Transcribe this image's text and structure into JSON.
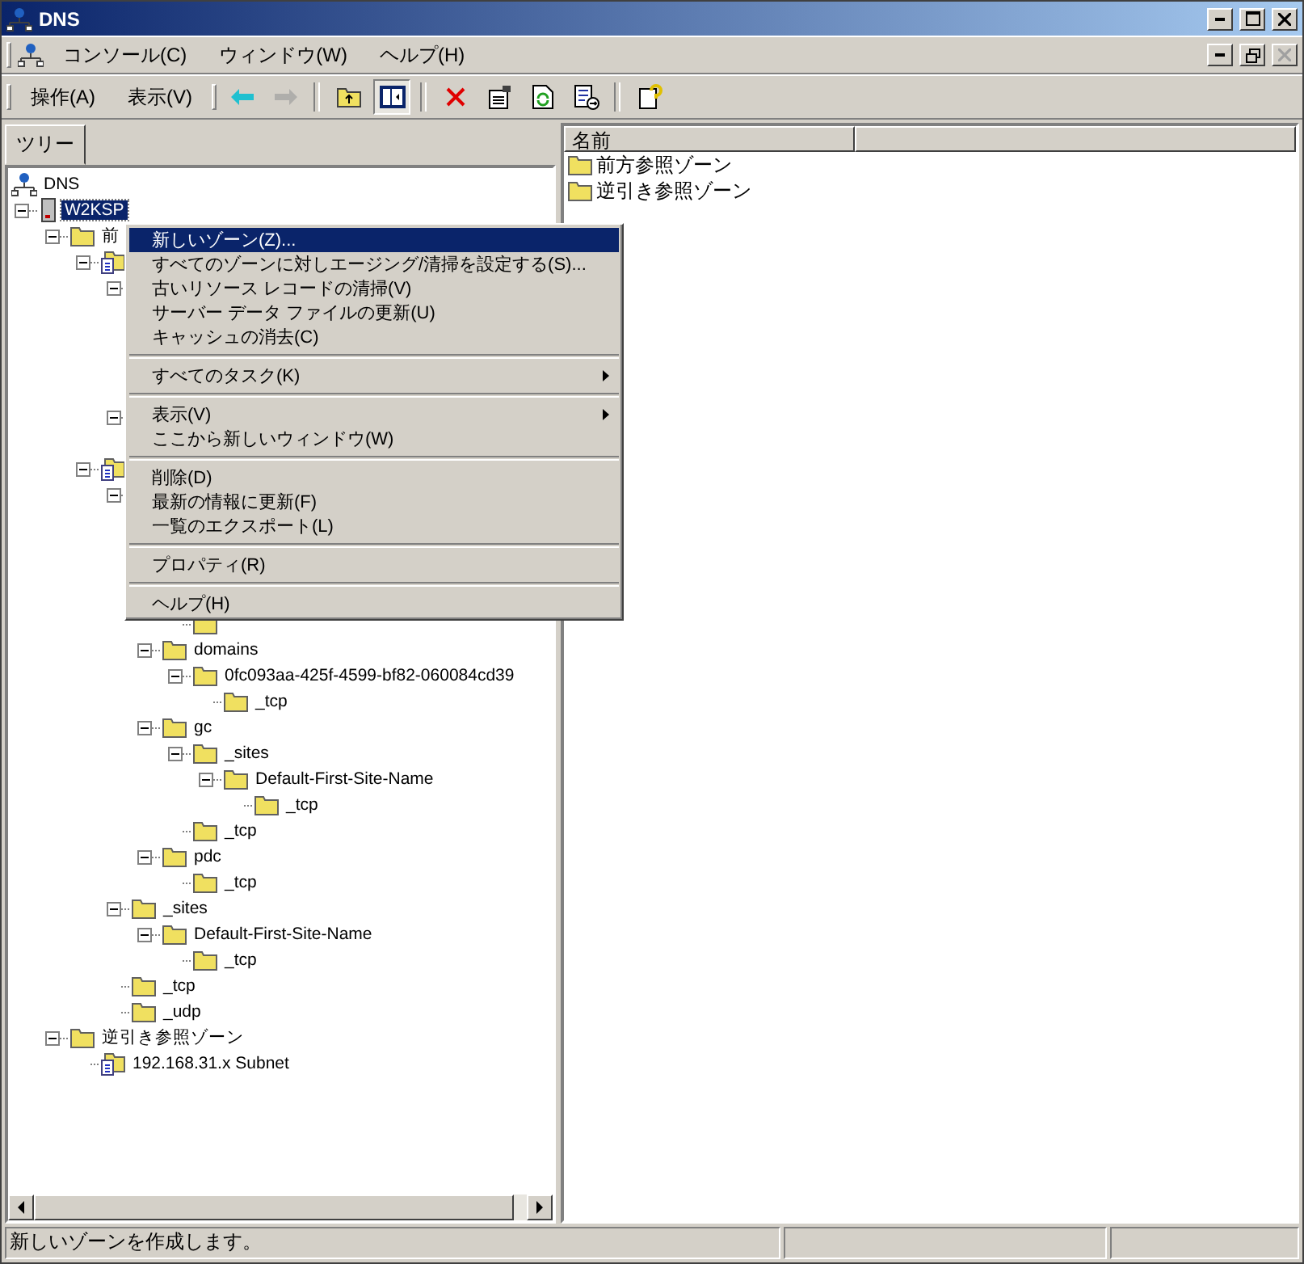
{
  "window": {
    "title": "DNS"
  },
  "menu_bar": [
    "コンソール(C)",
    "ウィンドウ(W)",
    "ヘルプ(H)"
  ],
  "action_menu": [
    "操作(A)",
    "表示(V)"
  ],
  "toolbar": [
    {
      "kind": "back",
      "disabled": false
    },
    {
      "kind": "forward",
      "disabled": true
    },
    {
      "kind": "sep"
    },
    {
      "kind": "up",
      "disabled": false
    },
    {
      "kind": "tree",
      "disabled": false,
      "pressed": true
    },
    {
      "kind": "sep"
    },
    {
      "kind": "delete",
      "disabled": false
    },
    {
      "kind": "properties",
      "disabled": false
    },
    {
      "kind": "refresh",
      "disabled": false
    },
    {
      "kind": "export",
      "disabled": false
    },
    {
      "kind": "sep"
    },
    {
      "kind": "help",
      "disabled": false
    }
  ],
  "tree_tab": "ツリー",
  "tree": [
    {
      "label": "DNS",
      "kind": "dns",
      "children": [
        {
          "label": "W2KSP",
          "kind": "server",
          "expanded": true,
          "selected": true,
          "children": [
            {
              "label": "前",
              "kind": "folder",
              "expanded": true,
              "selected": false,
              "children": [
                {
                  "kind": "zone",
                  "expanded": true,
                  "children": [
                    {
                      "kind": "folder",
                      "expanded": true,
                      "children": [
                        {
                          "kind": "folder"
                        },
                        {
                          "kind": "folder"
                        },
                        {
                          "kind": "folder"
                        },
                        {
                          "kind": "folder"
                        }
                      ]
                    },
                    {
                      "kind": "folder",
                      "expanded": true,
                      "children": [
                        {
                          "kind": "folder"
                        }
                      ]
                    }
                  ]
                },
                {
                  "kind": "zone",
                  "expanded": true,
                  "children": [
                    {
                      "kind": "folder",
                      "expanded": true,
                      "children": [
                        {
                          "kind": "folder",
                          "children": [
                            {
                              "kind": "folder",
                              "children": [
                                {
                                  "kind": "folder",
                                  "children": [
                                    {
                                      "kind": "folder"
                                    }
                                  ]
                                }
                              ]
                            },
                            {
                              "kind": "folder"
                            }
                          ]
                        },
                        {
                          "label": "domains",
                          "kind": "folder",
                          "expanded": true,
                          "selected": false,
                          "children": [
                            {
                              "label": "0fc093aa-425f-4599-bf82-060084cd39",
                              "kind": "folder",
                              "expanded": true,
                              "selected": false,
                              "children": [
                                {
                                  "label": "_tcp",
                                  "kind": "folder",
                                  "selected": false
                                }
                              ]
                            }
                          ]
                        },
                        {
                          "label": "gc",
                          "kind": "folder",
                          "expanded": true,
                          "selected": false,
                          "children": [
                            {
                              "label": "_sites",
                              "kind": "folder",
                              "expanded": true,
                              "selected": false,
                              "children": [
                                {
                                  "label": "Default-First-Site-Name",
                                  "kind": "folder",
                                  "expanded": true,
                                  "selected": false,
                                  "children": [
                                    {
                                      "label": "_tcp",
                                      "kind": "folder",
                                      "selected": false
                                    }
                                  ]
                                }
                              ]
                            },
                            {
                              "label": "_tcp",
                              "kind": "folder",
                              "selected": false
                            }
                          ]
                        },
                        {
                          "label": "pdc",
                          "kind": "folder",
                          "expanded": true,
                          "selected": false,
                          "children": [
                            {
                              "label": "_tcp",
                              "kind": "folder",
                              "selected": false
                            }
                          ]
                        }
                      ]
                    },
                    {
                      "label": "_sites",
                      "kind": "folder",
                      "expanded": true,
                      "selected": false,
                      "children": [
                        {
                          "label": "Default-First-Site-Name",
                          "kind": "folder",
                          "expanded": true,
                          "selected": false,
                          "children": [
                            {
                              "label": "_tcp",
                              "kind": "folder",
                              "selected": false
                            }
                          ]
                        }
                      ]
                    },
                    {
                      "label": "_tcp",
                      "kind": "folder",
                      "selected": false
                    },
                    {
                      "label": "_udp",
                      "kind": "folder",
                      "selected": false
                    }
                  ]
                }
              ]
            },
            {
              "label": "逆引き参照ゾーン",
              "kind": "folder",
              "expanded": true,
              "selected": false,
              "children": [
                {
                  "label": "192.168.31.x Subnet",
                  "kind": "zone",
                  "selected": false
                }
              ]
            }
          ]
        }
      ]
    }
  ],
  "context_menu": [
    {
      "kind": "item",
      "label": "新しいゾーン(Z)...",
      "selected": true,
      "submenu": false
    },
    {
      "kind": "item",
      "label": "すべてのゾーンに対しエージング/清掃を設定する(S)...",
      "selected": false,
      "submenu": false
    },
    {
      "kind": "item",
      "label": "古いリソース レコードの清掃(V)",
      "selected": false,
      "submenu": false
    },
    {
      "kind": "item",
      "label": "サーバー データ ファイルの更新(U)",
      "selected": false,
      "submenu": false
    },
    {
      "kind": "item",
      "label": "キャッシュの消去(C)",
      "selected": false,
      "submenu": false
    },
    {
      "kind": "separator"
    },
    {
      "kind": "item",
      "label": "すべてのタスク(K)",
      "selected": false,
      "submenu": true
    },
    {
      "kind": "separator"
    },
    {
      "kind": "item",
      "label": "表示(V)",
      "selected": false,
      "submenu": true
    },
    {
      "kind": "item",
      "label": "ここから新しいウィンドウ(W)",
      "selected": false,
      "submenu": false
    },
    {
      "kind": "separator"
    },
    {
      "kind": "item",
      "label": "削除(D)",
      "selected": false,
      "submenu": false
    },
    {
      "kind": "item",
      "label": "最新の情報に更新(F)",
      "selected": false,
      "submenu": false
    },
    {
      "kind": "item",
      "label": "一覧のエクスポート(L)",
      "selected": false,
      "submenu": false
    },
    {
      "kind": "separator"
    },
    {
      "kind": "item",
      "label": "プロパティ(R)",
      "selected": false,
      "submenu": false
    },
    {
      "kind": "separator"
    },
    {
      "kind": "item",
      "label": "ヘルプ(H)",
      "selected": false,
      "submenu": false
    }
  ],
  "list": {
    "columns": [
      "名前"
    ],
    "rows": [
      {
        "label": "前方参照ゾーン",
        "selected": false
      },
      {
        "label": "逆引き参照ゾーン",
        "selected": false
      }
    ]
  },
  "status_bar": [
    "新しいゾーンを作成します。"
  ]
}
